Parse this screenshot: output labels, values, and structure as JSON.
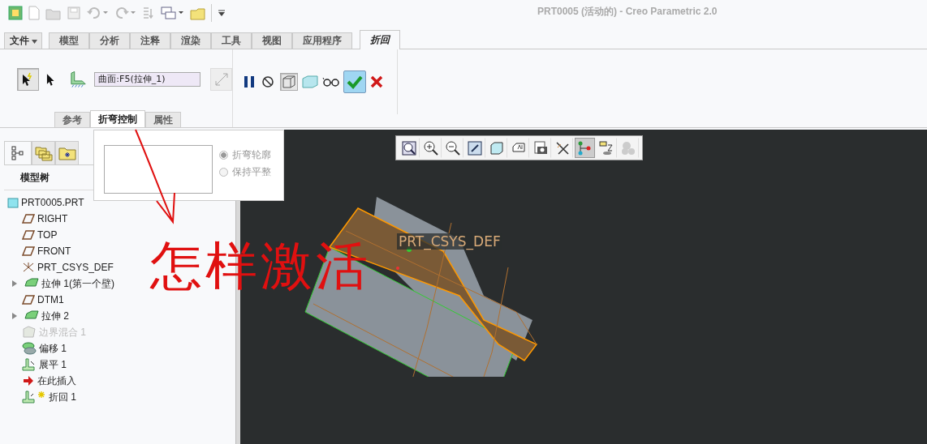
{
  "window": {
    "title": "PRT0005 (活动的) - Creo Parametric 2.0"
  },
  "ribbon_tabs": [
    {
      "label": "文件",
      "kind": "menu",
      "selected": false
    },
    {
      "label": "模型",
      "kind": "tab",
      "selected": false
    },
    {
      "label": "分析",
      "kind": "tab",
      "selected": false
    },
    {
      "label": "注释",
      "kind": "tab",
      "selected": false
    },
    {
      "label": "渲染",
      "kind": "tab",
      "selected": false
    },
    {
      "label": "工具",
      "kind": "tab",
      "selected": false
    },
    {
      "label": "视图",
      "kind": "tab",
      "selected": false
    },
    {
      "label": "应用程序",
      "kind": "tab",
      "selected": false
    },
    {
      "label": "折回",
      "kind": "context",
      "selected": true
    }
  ],
  "dashboard": {
    "collector": {
      "value": "曲面:F5(拉伸_1)"
    },
    "subtabs": [
      {
        "label": "参考",
        "selected": false
      },
      {
        "label": "折弯控制",
        "selected": true
      },
      {
        "label": "属性",
        "selected": false
      }
    ]
  },
  "bend_control_panel": {
    "options": [
      {
        "label": "折弯轮廓",
        "selected": true
      },
      {
        "label": "保持平整",
        "selected": false
      }
    ]
  },
  "navigator_tabs": [
    {
      "kind": "tree",
      "selected": true
    },
    {
      "kind": "layers",
      "selected": false
    },
    {
      "kind": "favorites",
      "selected": false
    }
  ],
  "model_tree": {
    "title": "模型树",
    "items": [
      {
        "label": "PRT0005.PRT",
        "kind": "part",
        "expandable": false,
        "disabled": false
      },
      {
        "label": "RIGHT",
        "kind": "plane",
        "expandable": false,
        "disabled": false
      },
      {
        "label": "TOP",
        "kind": "plane",
        "expandable": false,
        "disabled": false
      },
      {
        "label": "FRONT",
        "kind": "plane",
        "expandable": false,
        "disabled": false
      },
      {
        "label": "PRT_CSYS_DEF",
        "kind": "csys",
        "expandable": false,
        "disabled": false
      },
      {
        "label": "拉伸 1(第一个壁)",
        "kind": "extrude",
        "expandable": true,
        "disabled": false
      },
      {
        "label": "DTM1",
        "kind": "plane",
        "expandable": false,
        "disabled": false
      },
      {
        "label": "拉伸 2",
        "kind": "extrude",
        "expandable": true,
        "disabled": false
      },
      {
        "label": "边界混合 1",
        "kind": "blend",
        "expandable": false,
        "disabled": true
      },
      {
        "label": "偏移 1",
        "kind": "offset",
        "expandable": false,
        "disabled": false
      },
      {
        "label": "展平 1",
        "kind": "flatten",
        "expandable": false,
        "disabled": false
      },
      {
        "label": "在此插入",
        "kind": "insert",
        "expandable": false,
        "disabled": false
      },
      {
        "label": "折回 1",
        "kind": "bendback",
        "expandable": false,
        "disabled": false
      }
    ]
  },
  "viewport_toolbar": [
    {
      "kind": "zoom-fit",
      "pressed": false
    },
    {
      "kind": "zoom-in",
      "pressed": false
    },
    {
      "kind": "zoom-out",
      "pressed": false
    },
    {
      "kind": "repaint",
      "pressed": false
    },
    {
      "kind": "cube",
      "pressed": false
    },
    {
      "kind": "views",
      "pressed": false
    },
    {
      "kind": "camera",
      "pressed": false
    },
    {
      "kind": "datum",
      "pressed": false
    },
    {
      "kind": "nodes",
      "pressed": true
    },
    {
      "kind": "spin",
      "pressed": false
    },
    {
      "kind": "gears",
      "pressed": false
    }
  ],
  "viewport": {
    "csys_label": "PRT_CSYS_DEF"
  },
  "annotation": {
    "text": "怎样激活"
  }
}
